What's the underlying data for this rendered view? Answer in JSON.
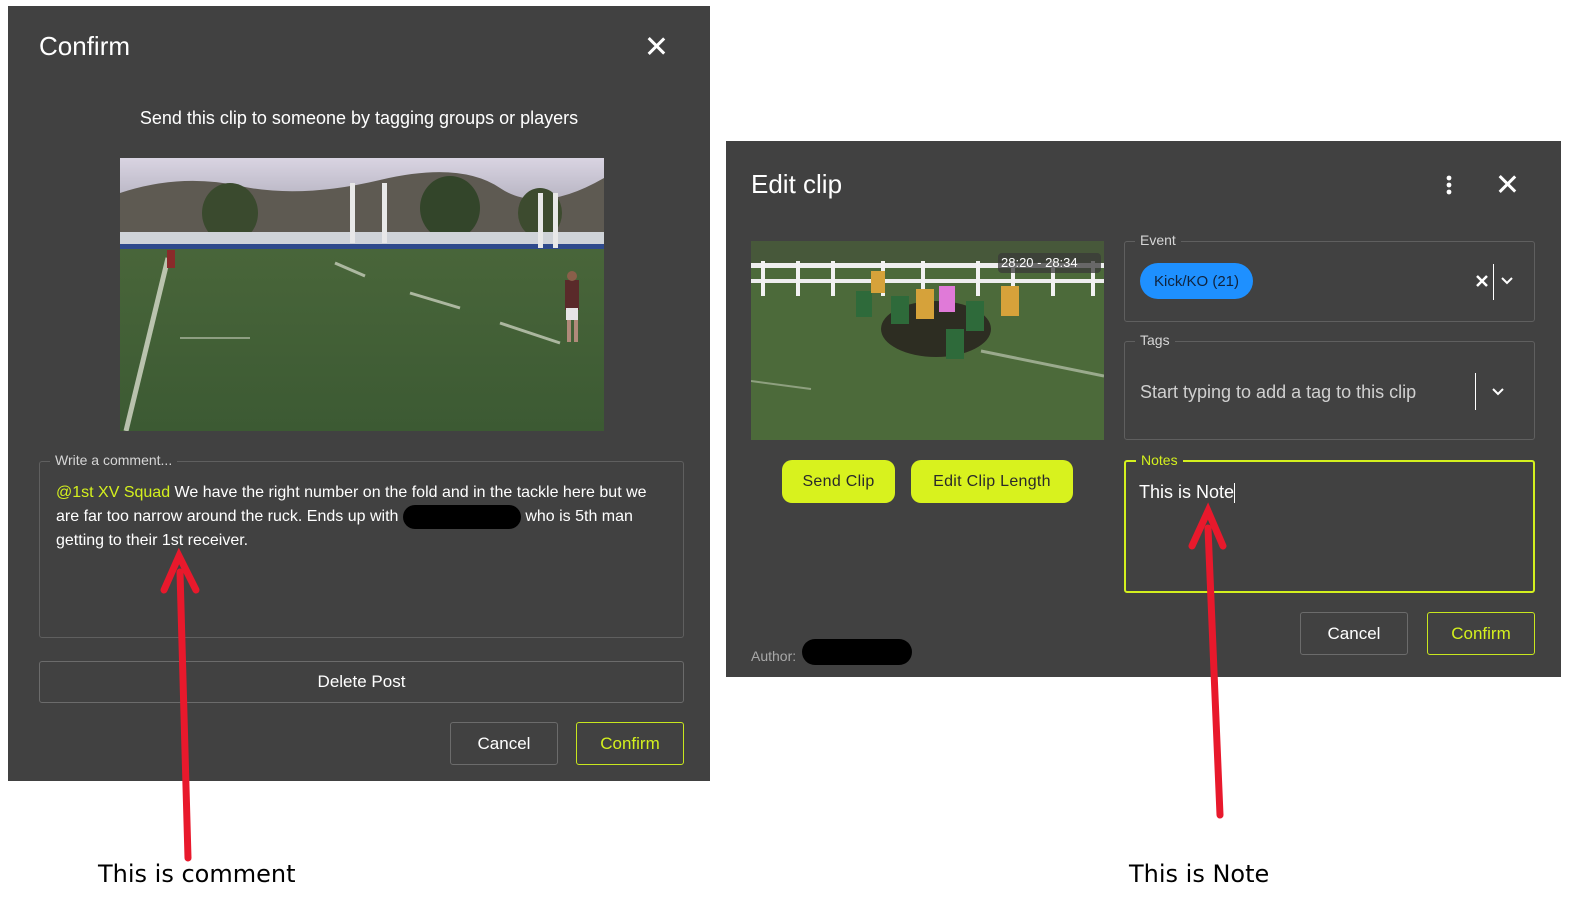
{
  "confirm_dialog": {
    "title": "Confirm",
    "subtitle": "Send this clip to someone by tagging groups or players",
    "comment_label": "Write a comment...",
    "comment_mention": "@1st XV Squad",
    "comment_text_1": " We have the right number on the fold and in the tackle here but we are far too narrow around the ruck. Ends up with",
    "comment_text_2": "who is 5th man getting to their 1st receiver.",
    "delete_label": "Delete Post",
    "cancel_label": "Cancel",
    "confirm_label": "Confirm"
  },
  "edit_dialog": {
    "title": "Edit clip",
    "timecode": "28:20 - 28:34",
    "send_clip_label": "Send Clip",
    "edit_length_label": "Edit Clip Length",
    "author_label": "Author:",
    "event_label": "Event",
    "event_chip": "Kick/KO (21)",
    "tags_label": "Tags",
    "tags_placeholder": "Start typing to add a tag to this clip",
    "notes_label": "Notes",
    "notes_value": "This is Note",
    "cancel_label": "Cancel",
    "confirm_label": "Confirm"
  },
  "annotations": {
    "comment_caption": "This is comment",
    "note_caption": "This is Note"
  },
  "colors": {
    "dialog_bg": "#414141",
    "accent": "#d4f01e",
    "chip": "#1e90ff",
    "arrow": "#e8192c"
  },
  "icons": [
    "close-icon",
    "more-vert-icon",
    "clear-icon",
    "chevron-down-icon"
  ]
}
